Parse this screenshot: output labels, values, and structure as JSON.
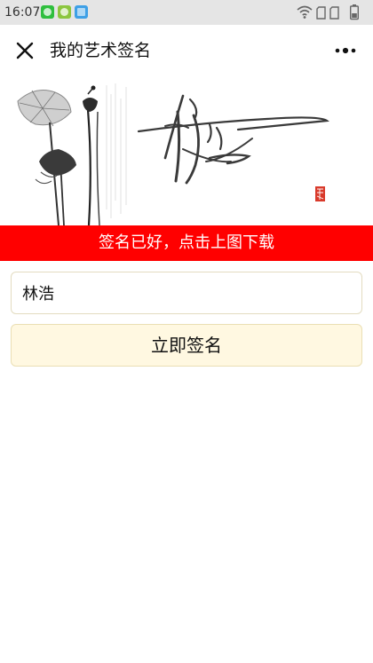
{
  "status_bar": {
    "time": "16:07",
    "notification_icons": [
      "wechat-icon",
      "game-icon",
      "app-icon"
    ],
    "system_icons": [
      "wifi-icon",
      "sim-card-icon",
      "sim-card-icon",
      "battery-icon"
    ]
  },
  "header": {
    "title": "我的艺术签名",
    "close_icon": "close-icon",
    "more_icon": "more-dots-icon"
  },
  "signature": {
    "text": "林浩",
    "seal_color": "#d93a2b"
  },
  "notice": {
    "text": "签名已好，点击上图下载",
    "color": "#ff0000"
  },
  "form": {
    "name_value": "林浩",
    "submit_label": "立即签名",
    "button_background": "#fff8e1"
  }
}
